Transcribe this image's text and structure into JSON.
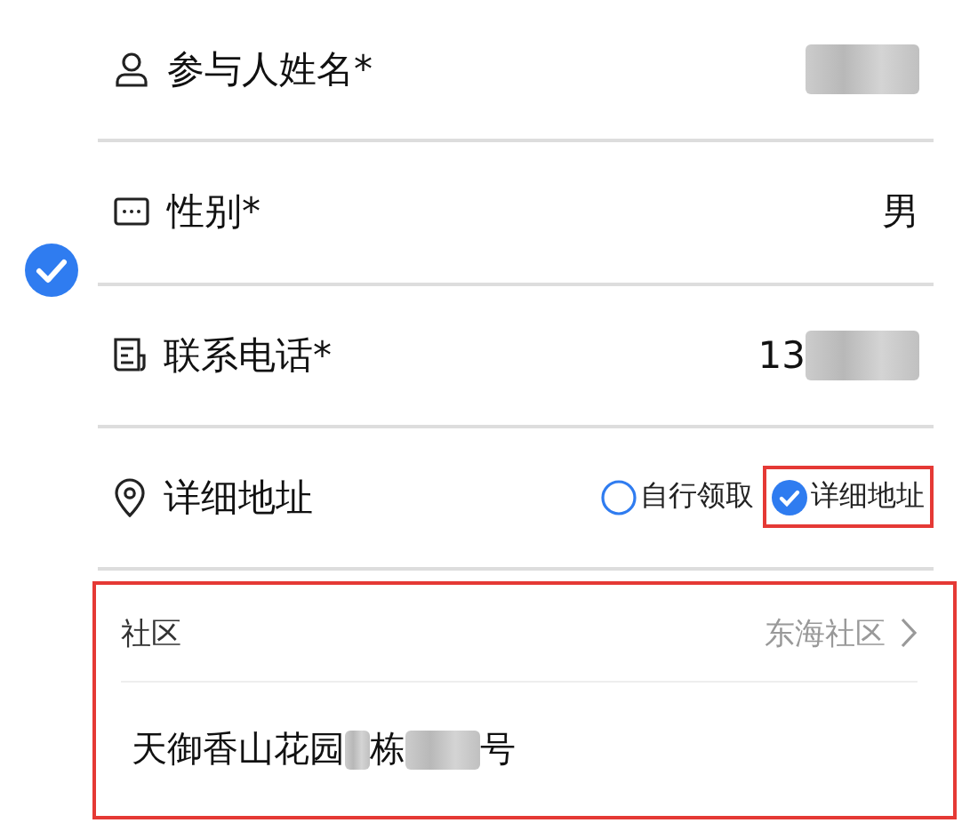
{
  "row_checked": true,
  "fields": [
    {
      "label": "参与人姓名*",
      "value": [
        {
          "kind": "masked"
        }
      ]
    },
    {
      "label": "性别*",
      "value": [
        {
          "kind": "text",
          "text": "男"
        }
      ]
    },
    {
      "label": "联系电话*",
      "value": [
        {
          "kind": "text",
          "text": "13"
        },
        {
          "kind": "masked"
        }
      ]
    },
    {
      "label": "详细地址",
      "options": [
        {
          "label": "自行领取",
          "selected": false,
          "highlighted": false
        },
        {
          "label": "详细地址",
          "selected": true,
          "highlighted": true
        }
      ]
    }
  ],
  "address_section": {
    "highlighted": true,
    "community_label": "社区",
    "community_value": "东海社区",
    "address": [
      {
        "kind": "text",
        "text": "天御香山花园"
      },
      {
        "kind": "masked"
      },
      {
        "kind": "text",
        "text": "栋"
      },
      {
        "kind": "masked"
      },
      {
        "kind": "text",
        "text": "号"
      }
    ]
  }
}
